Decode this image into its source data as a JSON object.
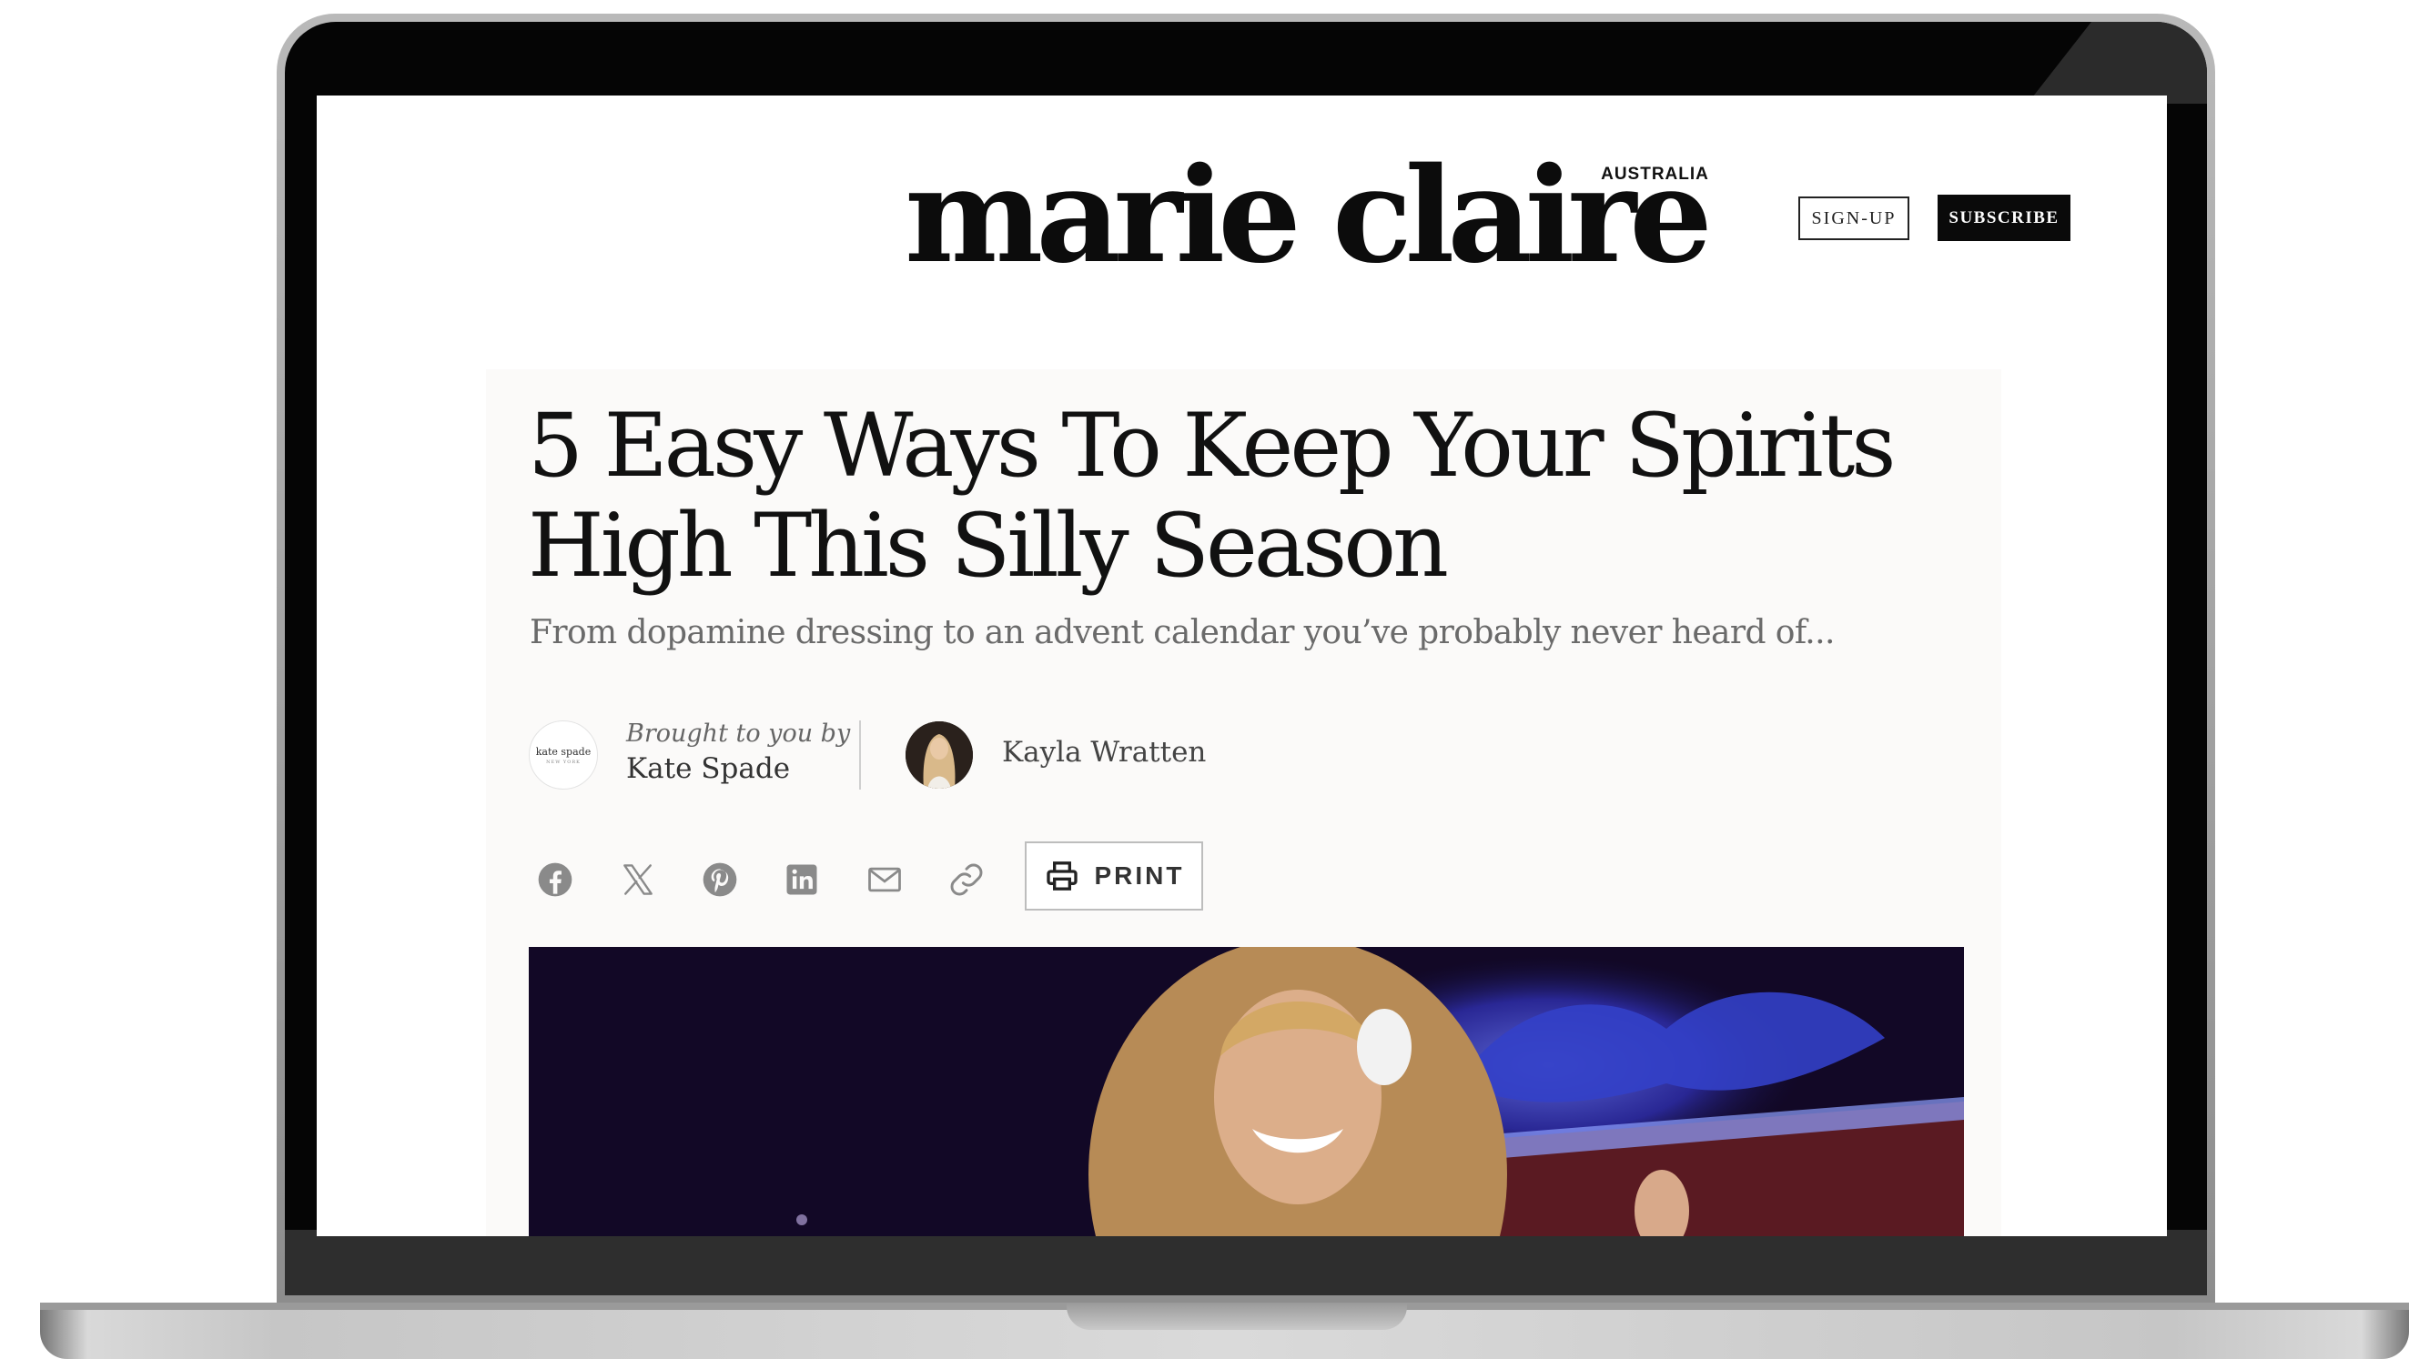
{
  "site": {
    "logo_text": "marie claire",
    "logo_region": "AUSTRALIA",
    "signup_label": "SIGN-UP",
    "subscribe_label": "SUBSCRIBE"
  },
  "article": {
    "headline": "5 Easy Ways To Keep Your Spirits High This Silly Season",
    "dek": "From dopamine dressing to an advent calendar you’ve probably never heard of...",
    "sponsor": {
      "prefix": "Brought to you by",
      "name": "Kate Spade",
      "logo_text": "kate spade",
      "logo_subtext": "NEW YORK"
    },
    "author": {
      "name": "Kayla Wratten"
    },
    "share_icons": [
      "facebook-icon",
      "x-icon",
      "pinterest-icon",
      "linkedin-icon",
      "email-icon",
      "link-icon"
    ],
    "print_label": "PRINT"
  },
  "colors": {
    "text": "#111111",
    "dek": "#6a6a6a",
    "subscribe_bg": "#0a0a0a",
    "icon": "#8a8a8a",
    "article_bg": "#fbfaf9"
  }
}
